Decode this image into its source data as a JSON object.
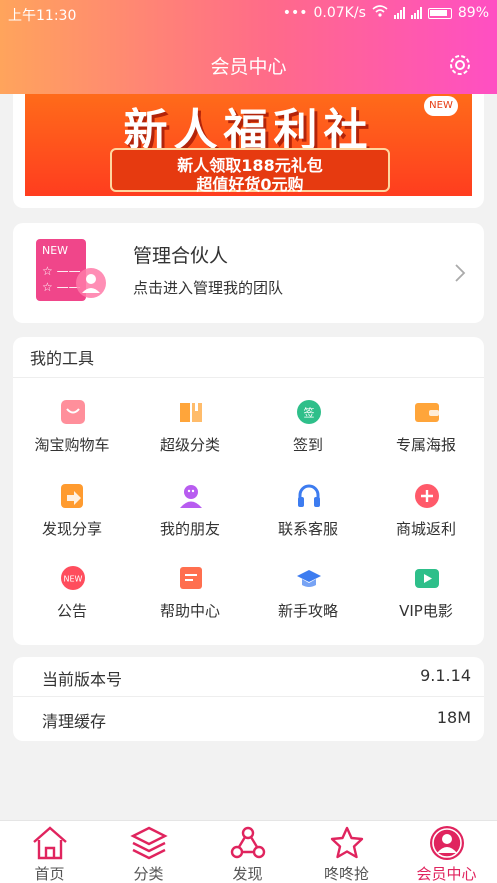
{
  "status": {
    "time": "上午11:30",
    "speed": "0.07K/s",
    "battery": "89%"
  },
  "header": {
    "title": "会员中心"
  },
  "banner": {
    "headline": "新人福利社",
    "line1": "新人领取188元礼包",
    "line2": "超值好货0元购",
    "tag": "NEW"
  },
  "partner": {
    "title": "管理合伙人",
    "subtitle": "点击进入管理我的团队",
    "icon_tag": "NEW"
  },
  "tools": {
    "heading": "我的工具",
    "items": [
      {
        "label": "淘宝购物车",
        "icon": "cart-icon",
        "color": "#ff7b8a"
      },
      {
        "label": "超级分类",
        "icon": "book-icon",
        "color": "#ffa53a"
      },
      {
        "label": "签到",
        "icon": "sign-in-icon",
        "color": "#2ebf8a",
        "glyph": "签"
      },
      {
        "label": "专属海报",
        "icon": "wallet-icon",
        "color": "#ffa53a"
      },
      {
        "label": "发现分享",
        "icon": "share-icon",
        "color": "#ff9b2f"
      },
      {
        "label": "我的朋友",
        "icon": "friend-icon",
        "color": "#b85cf0"
      },
      {
        "label": "联系客服",
        "icon": "headset-icon",
        "color": "#3d7cf0"
      },
      {
        "label": "商城返利",
        "icon": "plus-icon",
        "color": "#ff5a6a"
      },
      {
        "label": "公告",
        "icon": "notice-icon",
        "color": "#ff4d5d",
        "glyph": "NEW"
      },
      {
        "label": "帮助中心",
        "icon": "help-doc-icon",
        "color": "#ff6f4f"
      },
      {
        "label": "新手攻略",
        "icon": "graduation-cap-icon",
        "color": "#3d7cf0"
      },
      {
        "label": "VIP电影",
        "icon": "video-icon",
        "color": "#2ebf8a"
      }
    ]
  },
  "settings": {
    "version_label": "当前版本号",
    "version_value": "9.1.14",
    "cache_label": "清理缓存",
    "cache_value": "18M"
  },
  "tabbar": {
    "items": [
      {
        "label": "首页",
        "icon": "home-icon"
      },
      {
        "label": "分类",
        "icon": "layers-icon"
      },
      {
        "label": "发现",
        "icon": "discover-icon"
      },
      {
        "label": "咚咚抢",
        "icon": "star-icon"
      },
      {
        "label": "会员中心",
        "icon": "member-icon",
        "active": true
      }
    ]
  },
  "colors": {
    "accent": "#e0245e",
    "header_start": "#ffa45c",
    "header_end": "#ff4fc3"
  }
}
